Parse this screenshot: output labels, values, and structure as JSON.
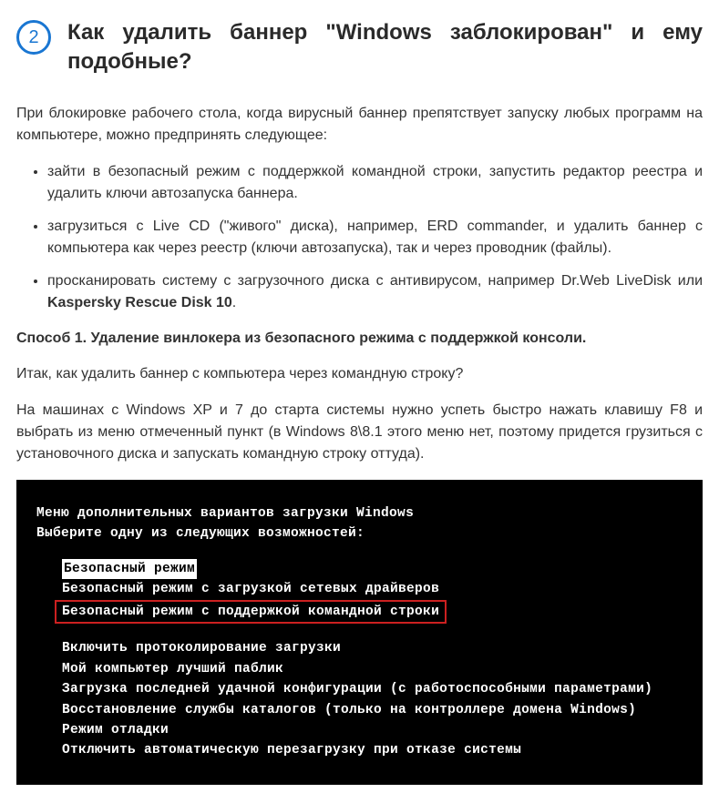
{
  "step": {
    "number": "2",
    "title": "Как удалить баннер \"Windows заблокирован\" и ему подобные?"
  },
  "intro": "При блокировке рабочего стола, когда вирусный баннер препятствует запуску любых программ на компьютере, можно предпринять следующее:",
  "bullets": {
    "b1": "зайти в безопасный режим с поддержкой командной строки, запустить редактор реестра и удалить ключи автозапуска баннера.",
    "b2": "загрузиться с Live CD (\"живого\" диска), например, ERD commander, и удалить баннер с компьютера как через реестр (ключи автозапуска), так и через проводник (файлы).",
    "b3_pre": "просканировать систему с загрузочного диска с антивирусом, например Dr.Web LiveDisk или ",
    "b3_bold": "Kaspersky Rescue Disk 10",
    "b3_post": "."
  },
  "method1_title": "Способ 1. Удаление винлокера из безопасного режима с поддержкой консоли.",
  "question": "Итак, как удалить баннер с компьютера через командную строку?",
  "instructions": "На машинах с Windows XP и 7 до старта системы нужно успеть быстро нажать клавишу F8 и выбрать из меню отмеченный пункт (в Windows 8\\8.1 этого меню нет, поэтому придется грузиться с установочного диска и запускать командную строку оттуда).",
  "boot_menu": {
    "title": "Меню дополнительных вариантов загрузки Windows",
    "prompt": "Выберите одну из следующих возможностей:",
    "opt_safe": "Безопасный режим",
    "opt_safe_net": "Безопасный режим с загрузкой сетевых драйверов",
    "opt_safe_cmd": "Безопасный режим с поддержкой командной строки",
    "opt_log": "Включить протоколирование загрузки",
    "opt_best": "Мой компьютер лучший паблик",
    "opt_lastgood": "Загрузка последней удачной конфигурации (с работоспособными параметрами)",
    "opt_dsrm": "Восстановление службы каталогов (только на контроллере домена Windows)",
    "opt_debug": "Режим отладки",
    "opt_noreboot": "Отключить автоматическую перезагрузку при отказе системы"
  }
}
